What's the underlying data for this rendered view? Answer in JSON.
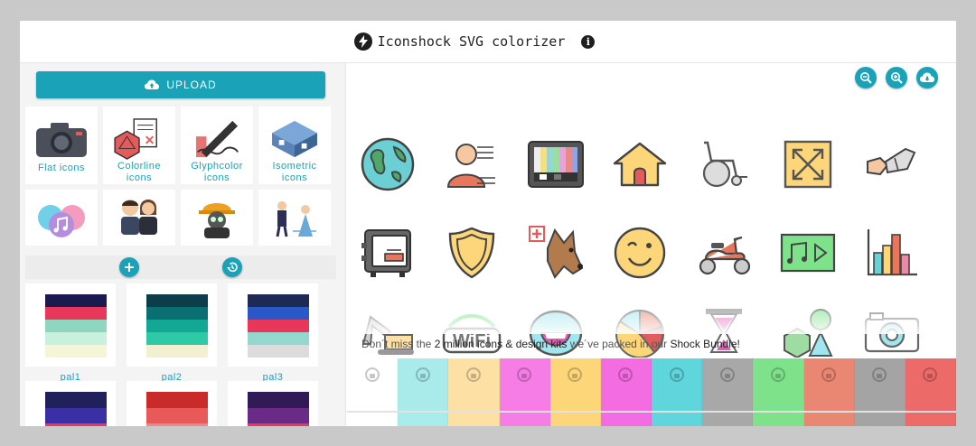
{
  "app": {
    "title": "Iconshock SVG colorizer",
    "info_label": "i"
  },
  "left": {
    "upload_label": "UPLOAD",
    "categories": [
      {
        "label_1": "Flat icons",
        "label_2": ""
      },
      {
        "label_1": "Colorline",
        "label_2": "icons"
      },
      {
        "label_1": "Glyphcolor",
        "label_2": "icons"
      },
      {
        "label_1": "Isometric",
        "label_2": "icons"
      }
    ],
    "palettes": [
      {
        "name": "pal1",
        "colors": [
          "#1a1a4e",
          "#e8375a",
          "#8fd6c0",
          "#c9f0dd",
          "#f5f6d8"
        ]
      },
      {
        "name": "pal2",
        "colors": [
          "#0d3d4a",
          "#0b6f72",
          "#13a894",
          "#2ec9a6",
          "#f2f0d0"
        ]
      },
      {
        "name": "pal3",
        "colors": [
          "#1c2a55",
          "#2a58c8",
          "#e8375a",
          "#93d8cc",
          "#dcdcdc"
        ]
      },
      {
        "name": "",
        "colors": [
          "#20205a",
          "#3a2fa5",
          "#e8375a",
          "#5cc8b7"
        ]
      },
      {
        "name": "",
        "colors": [
          "#c92b2b",
          "#e85a5a",
          "#e38b8b",
          "#d6a8a8"
        ]
      },
      {
        "name": "",
        "colors": [
          "#311a55",
          "#6a2b88",
          "#e8375a",
          "#f0a060"
        ]
      }
    ]
  },
  "right": {
    "promo_prefix": "Don´t miss the ",
    "promo_highlight": "2 million icons & design kits",
    "promo_mid": " we´ve packed in our ",
    "promo_bundle": "Shock Bundle!",
    "lock_colors": [
      "#ffffff",
      "#a9ebeb",
      "#fde0a4",
      "#f57de5",
      "#fcd679",
      "#f46ce1",
      "#5fd5dc",
      "#a8a8a8",
      "#7de289",
      "#e98772",
      "#a4a4a4",
      "#ec6a68"
    ]
  }
}
